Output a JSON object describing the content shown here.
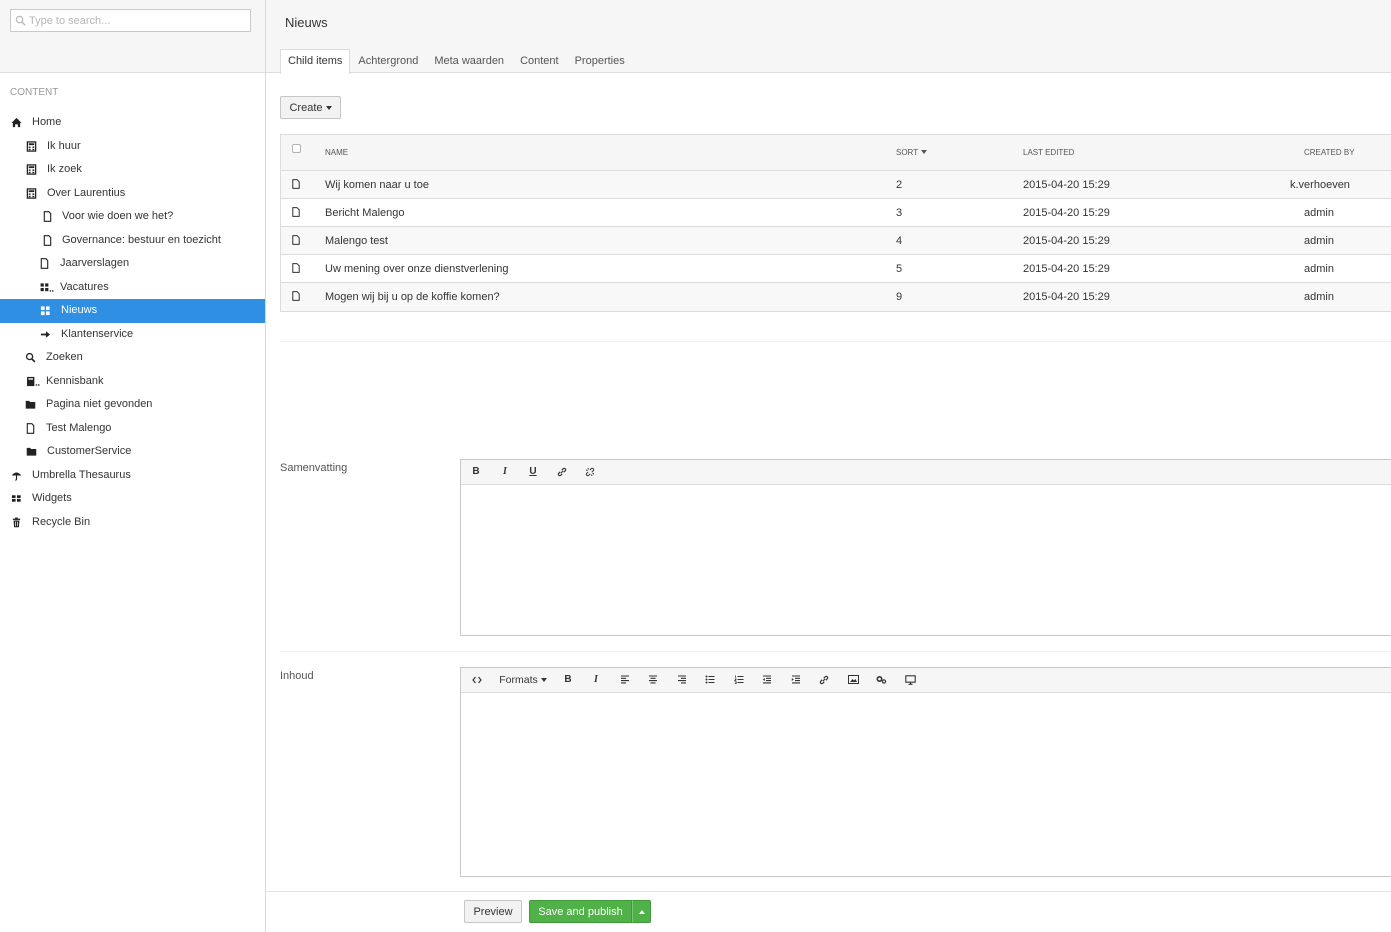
{
  "search": {
    "placeholder": "Type to search..."
  },
  "sidebar": {
    "section_title": "CONTENT",
    "tree": [
      {
        "label": "Home",
        "icon": "home-icon"
      },
      {
        "label": "Ik huur",
        "icon": "calculator-icon"
      },
      {
        "label": "Ik zoek",
        "icon": "calculator-icon"
      },
      {
        "label": "Over Laurentius",
        "icon": "calculator-icon"
      },
      {
        "label": "Voor wie doen we het?",
        "icon": "document-icon"
      },
      {
        "label": "Governance: bestuur en toezicht",
        "icon": "document-icon"
      },
      {
        "label": "Jaarverslagen",
        "icon": "document-icon"
      },
      {
        "label": "Vacatures",
        "icon": "grid-list-icon"
      },
      {
        "label": "Nieuws",
        "icon": "grid-icon",
        "selected": true
      },
      {
        "label": "Klantenservice",
        "icon": "arrow-right-icon"
      },
      {
        "label": "Zoeken",
        "icon": "search-icon"
      },
      {
        "label": "Kennisbank",
        "icon": "book-icon"
      },
      {
        "label": "Pagina niet gevonden",
        "icon": "folder-icon"
      },
      {
        "label": "Test Malengo",
        "icon": "document-icon"
      },
      {
        "label": "CustomerService",
        "icon": "folder-icon"
      },
      {
        "label": "Umbrella Thesaurus",
        "icon": "umbrella-icon"
      },
      {
        "label": "Widgets",
        "icon": "widgets-icon"
      },
      {
        "label": "Recycle Bin",
        "icon": "trash-icon"
      }
    ]
  },
  "main": {
    "title": "Nieuws",
    "tabs": [
      "Child items",
      "Achtergrond",
      "Meta waarden",
      "Content",
      "Properties"
    ],
    "create_label": "Create",
    "table": {
      "headers": {
        "name": "NAME",
        "sort": "SORT",
        "last_edited": "LAST EDITED",
        "created_by": "CREATED BY"
      },
      "rows": [
        {
          "name": "Wij komen naar u toe",
          "sort": "2",
          "last_edited": "2015-04-20 15:29",
          "created_by": "k.verhoeven"
        },
        {
          "name": "Bericht Malengo",
          "sort": "3",
          "last_edited": "2015-04-20 15:29",
          "created_by": "admin"
        },
        {
          "name": "Malengo test",
          "sort": "4",
          "last_edited": "2015-04-20 15:29",
          "created_by": "admin"
        },
        {
          "name": "Uw mening over onze dienstverlening",
          "sort": "5",
          "last_edited": "2015-04-20 15:29",
          "created_by": "admin"
        },
        {
          "name": "Mogen wij bij u op de koffie komen?",
          "sort": "9",
          "last_edited": "2015-04-20 15:29",
          "created_by": "admin"
        }
      ]
    },
    "samenvatting": {
      "label": "Samenvatting",
      "toolbar": [
        "B",
        "I",
        "U",
        "link-icon",
        "unlink-icon"
      ]
    },
    "inhoud": {
      "label": "Inhoud",
      "formats_label": "Formats"
    }
  },
  "footer": {
    "preview_label": "Preview",
    "save_label": "Save and publish"
  }
}
